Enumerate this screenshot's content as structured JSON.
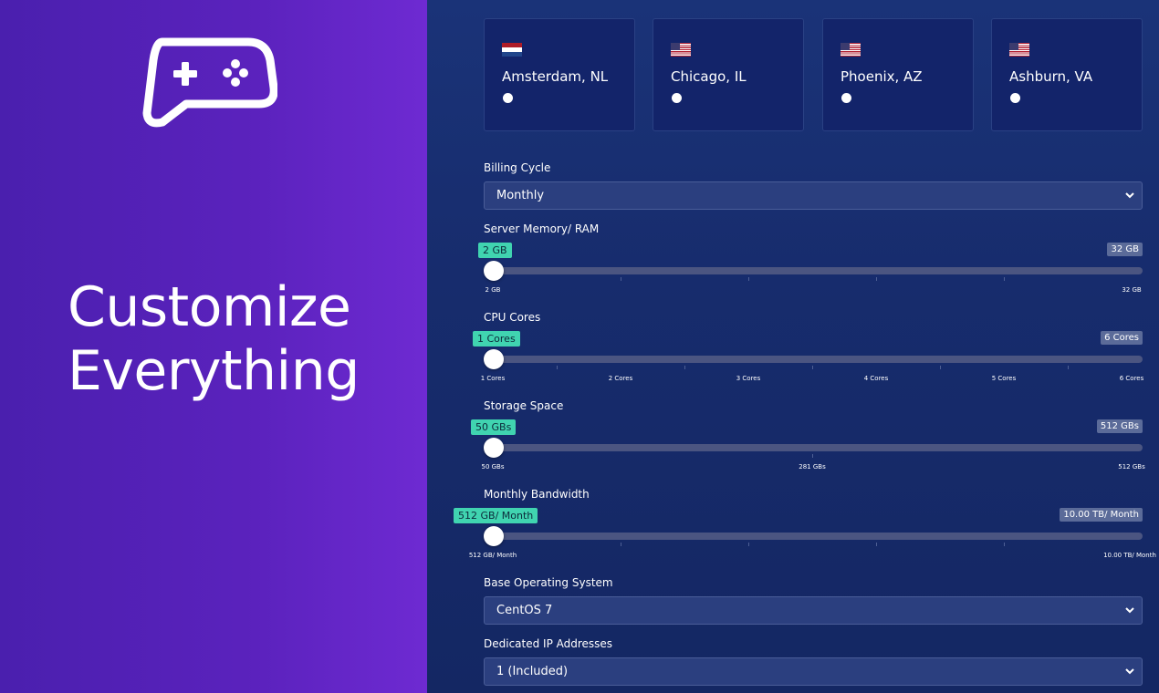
{
  "hero": {
    "headline_line1": "Customize",
    "headline_line2": "Everything"
  },
  "locations": [
    {
      "name": "Amsterdam, NL",
      "flag": "nl-flag-icon"
    },
    {
      "name": "Chicago, IL",
      "flag": "us-flag-icon"
    },
    {
      "name": "Phoenix, AZ",
      "flag": "us-flag-icon"
    },
    {
      "name": "Ashburn, VA",
      "flag": "us-flag-icon"
    }
  ],
  "billing": {
    "label": "Billing Cycle",
    "value": "Monthly"
  },
  "memory": {
    "label": "Server Memory/ RAM",
    "current": "2 GB",
    "max": "32 GB",
    "ticks": [
      "2 GB",
      "32 GB"
    ]
  },
  "cpu": {
    "label": "CPU Cores",
    "current": "1 Cores",
    "max": "6 Cores",
    "ticks": [
      "1 Cores",
      "2 Cores",
      "3 Cores",
      "4 Cores",
      "5 Cores",
      "6 Cores"
    ]
  },
  "storage": {
    "label": "Storage Space",
    "current": "50 GBs",
    "max": "512 GBs",
    "ticks": [
      "50 GBs",
      "281 GBs",
      "512 GBs"
    ]
  },
  "bandwidth": {
    "label": "Monthly Bandwidth",
    "current": "512 GB/ Month",
    "max": "10.00 TB/ Month",
    "ticks": [
      "512 GB/ Month",
      "10.00 TB/ Month"
    ]
  },
  "os": {
    "label": "Base Operating System",
    "value": "CentOS 7"
  },
  "ip": {
    "label": "Dedicated IP Addresses",
    "value": "1 (Included)"
  },
  "colors": {
    "left_bg": "#5b22bd",
    "right_bg": "#172c6d",
    "accent_badge": "#40d4b0"
  }
}
